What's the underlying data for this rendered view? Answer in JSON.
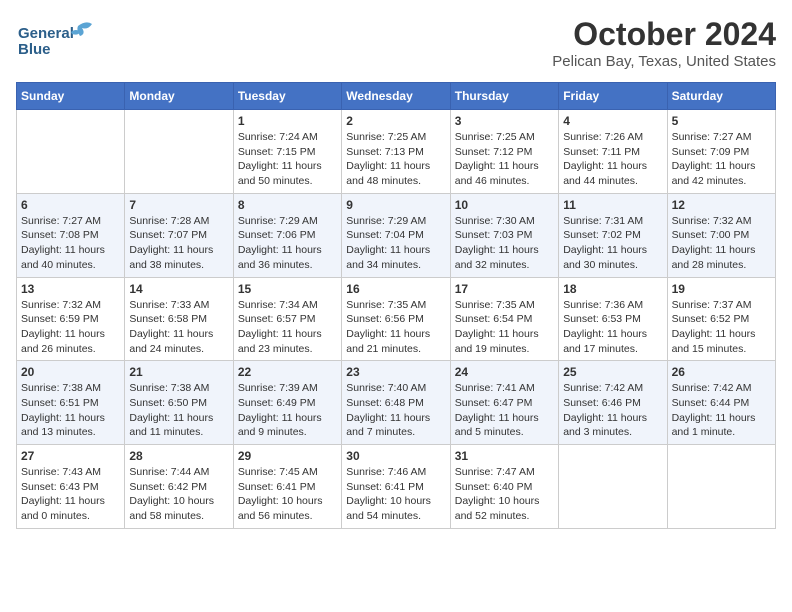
{
  "header": {
    "logo_line1": "General",
    "logo_line2": "Blue",
    "main_title": "October 2024",
    "subtitle": "Pelican Bay, Texas, United States"
  },
  "calendar": {
    "days_of_week": [
      "Sunday",
      "Monday",
      "Tuesday",
      "Wednesday",
      "Thursday",
      "Friday",
      "Saturday"
    ],
    "weeks": [
      [
        {
          "day": "",
          "content": ""
        },
        {
          "day": "",
          "content": ""
        },
        {
          "day": "1",
          "content": "Sunrise: 7:24 AM\nSunset: 7:15 PM\nDaylight: 11 hours and 50 minutes."
        },
        {
          "day": "2",
          "content": "Sunrise: 7:25 AM\nSunset: 7:13 PM\nDaylight: 11 hours and 48 minutes."
        },
        {
          "day": "3",
          "content": "Sunrise: 7:25 AM\nSunset: 7:12 PM\nDaylight: 11 hours and 46 minutes."
        },
        {
          "day": "4",
          "content": "Sunrise: 7:26 AM\nSunset: 7:11 PM\nDaylight: 11 hours and 44 minutes."
        },
        {
          "day": "5",
          "content": "Sunrise: 7:27 AM\nSunset: 7:09 PM\nDaylight: 11 hours and 42 minutes."
        }
      ],
      [
        {
          "day": "6",
          "content": "Sunrise: 7:27 AM\nSunset: 7:08 PM\nDaylight: 11 hours and 40 minutes."
        },
        {
          "day": "7",
          "content": "Sunrise: 7:28 AM\nSunset: 7:07 PM\nDaylight: 11 hours and 38 minutes."
        },
        {
          "day": "8",
          "content": "Sunrise: 7:29 AM\nSunset: 7:06 PM\nDaylight: 11 hours and 36 minutes."
        },
        {
          "day": "9",
          "content": "Sunrise: 7:29 AM\nSunset: 7:04 PM\nDaylight: 11 hours and 34 minutes."
        },
        {
          "day": "10",
          "content": "Sunrise: 7:30 AM\nSunset: 7:03 PM\nDaylight: 11 hours and 32 minutes."
        },
        {
          "day": "11",
          "content": "Sunrise: 7:31 AM\nSunset: 7:02 PM\nDaylight: 11 hours and 30 minutes."
        },
        {
          "day": "12",
          "content": "Sunrise: 7:32 AM\nSunset: 7:00 PM\nDaylight: 11 hours and 28 minutes."
        }
      ],
      [
        {
          "day": "13",
          "content": "Sunrise: 7:32 AM\nSunset: 6:59 PM\nDaylight: 11 hours and 26 minutes."
        },
        {
          "day": "14",
          "content": "Sunrise: 7:33 AM\nSunset: 6:58 PM\nDaylight: 11 hours and 24 minutes."
        },
        {
          "day": "15",
          "content": "Sunrise: 7:34 AM\nSunset: 6:57 PM\nDaylight: 11 hours and 23 minutes."
        },
        {
          "day": "16",
          "content": "Sunrise: 7:35 AM\nSunset: 6:56 PM\nDaylight: 11 hours and 21 minutes."
        },
        {
          "day": "17",
          "content": "Sunrise: 7:35 AM\nSunset: 6:54 PM\nDaylight: 11 hours and 19 minutes."
        },
        {
          "day": "18",
          "content": "Sunrise: 7:36 AM\nSunset: 6:53 PM\nDaylight: 11 hours and 17 minutes."
        },
        {
          "day": "19",
          "content": "Sunrise: 7:37 AM\nSunset: 6:52 PM\nDaylight: 11 hours and 15 minutes."
        }
      ],
      [
        {
          "day": "20",
          "content": "Sunrise: 7:38 AM\nSunset: 6:51 PM\nDaylight: 11 hours and 13 minutes."
        },
        {
          "day": "21",
          "content": "Sunrise: 7:38 AM\nSunset: 6:50 PM\nDaylight: 11 hours and 11 minutes."
        },
        {
          "day": "22",
          "content": "Sunrise: 7:39 AM\nSunset: 6:49 PM\nDaylight: 11 hours and 9 minutes."
        },
        {
          "day": "23",
          "content": "Sunrise: 7:40 AM\nSunset: 6:48 PM\nDaylight: 11 hours and 7 minutes."
        },
        {
          "day": "24",
          "content": "Sunrise: 7:41 AM\nSunset: 6:47 PM\nDaylight: 11 hours and 5 minutes."
        },
        {
          "day": "25",
          "content": "Sunrise: 7:42 AM\nSunset: 6:46 PM\nDaylight: 11 hours and 3 minutes."
        },
        {
          "day": "26",
          "content": "Sunrise: 7:42 AM\nSunset: 6:44 PM\nDaylight: 11 hours and 1 minute."
        }
      ],
      [
        {
          "day": "27",
          "content": "Sunrise: 7:43 AM\nSunset: 6:43 PM\nDaylight: 11 hours and 0 minutes."
        },
        {
          "day": "28",
          "content": "Sunrise: 7:44 AM\nSunset: 6:42 PM\nDaylight: 10 hours and 58 minutes."
        },
        {
          "day": "29",
          "content": "Sunrise: 7:45 AM\nSunset: 6:41 PM\nDaylight: 10 hours and 56 minutes."
        },
        {
          "day": "30",
          "content": "Sunrise: 7:46 AM\nSunset: 6:41 PM\nDaylight: 10 hours and 54 minutes."
        },
        {
          "day": "31",
          "content": "Sunrise: 7:47 AM\nSunset: 6:40 PM\nDaylight: 10 hours and 52 minutes."
        },
        {
          "day": "",
          "content": ""
        },
        {
          "day": "",
          "content": ""
        }
      ]
    ]
  }
}
